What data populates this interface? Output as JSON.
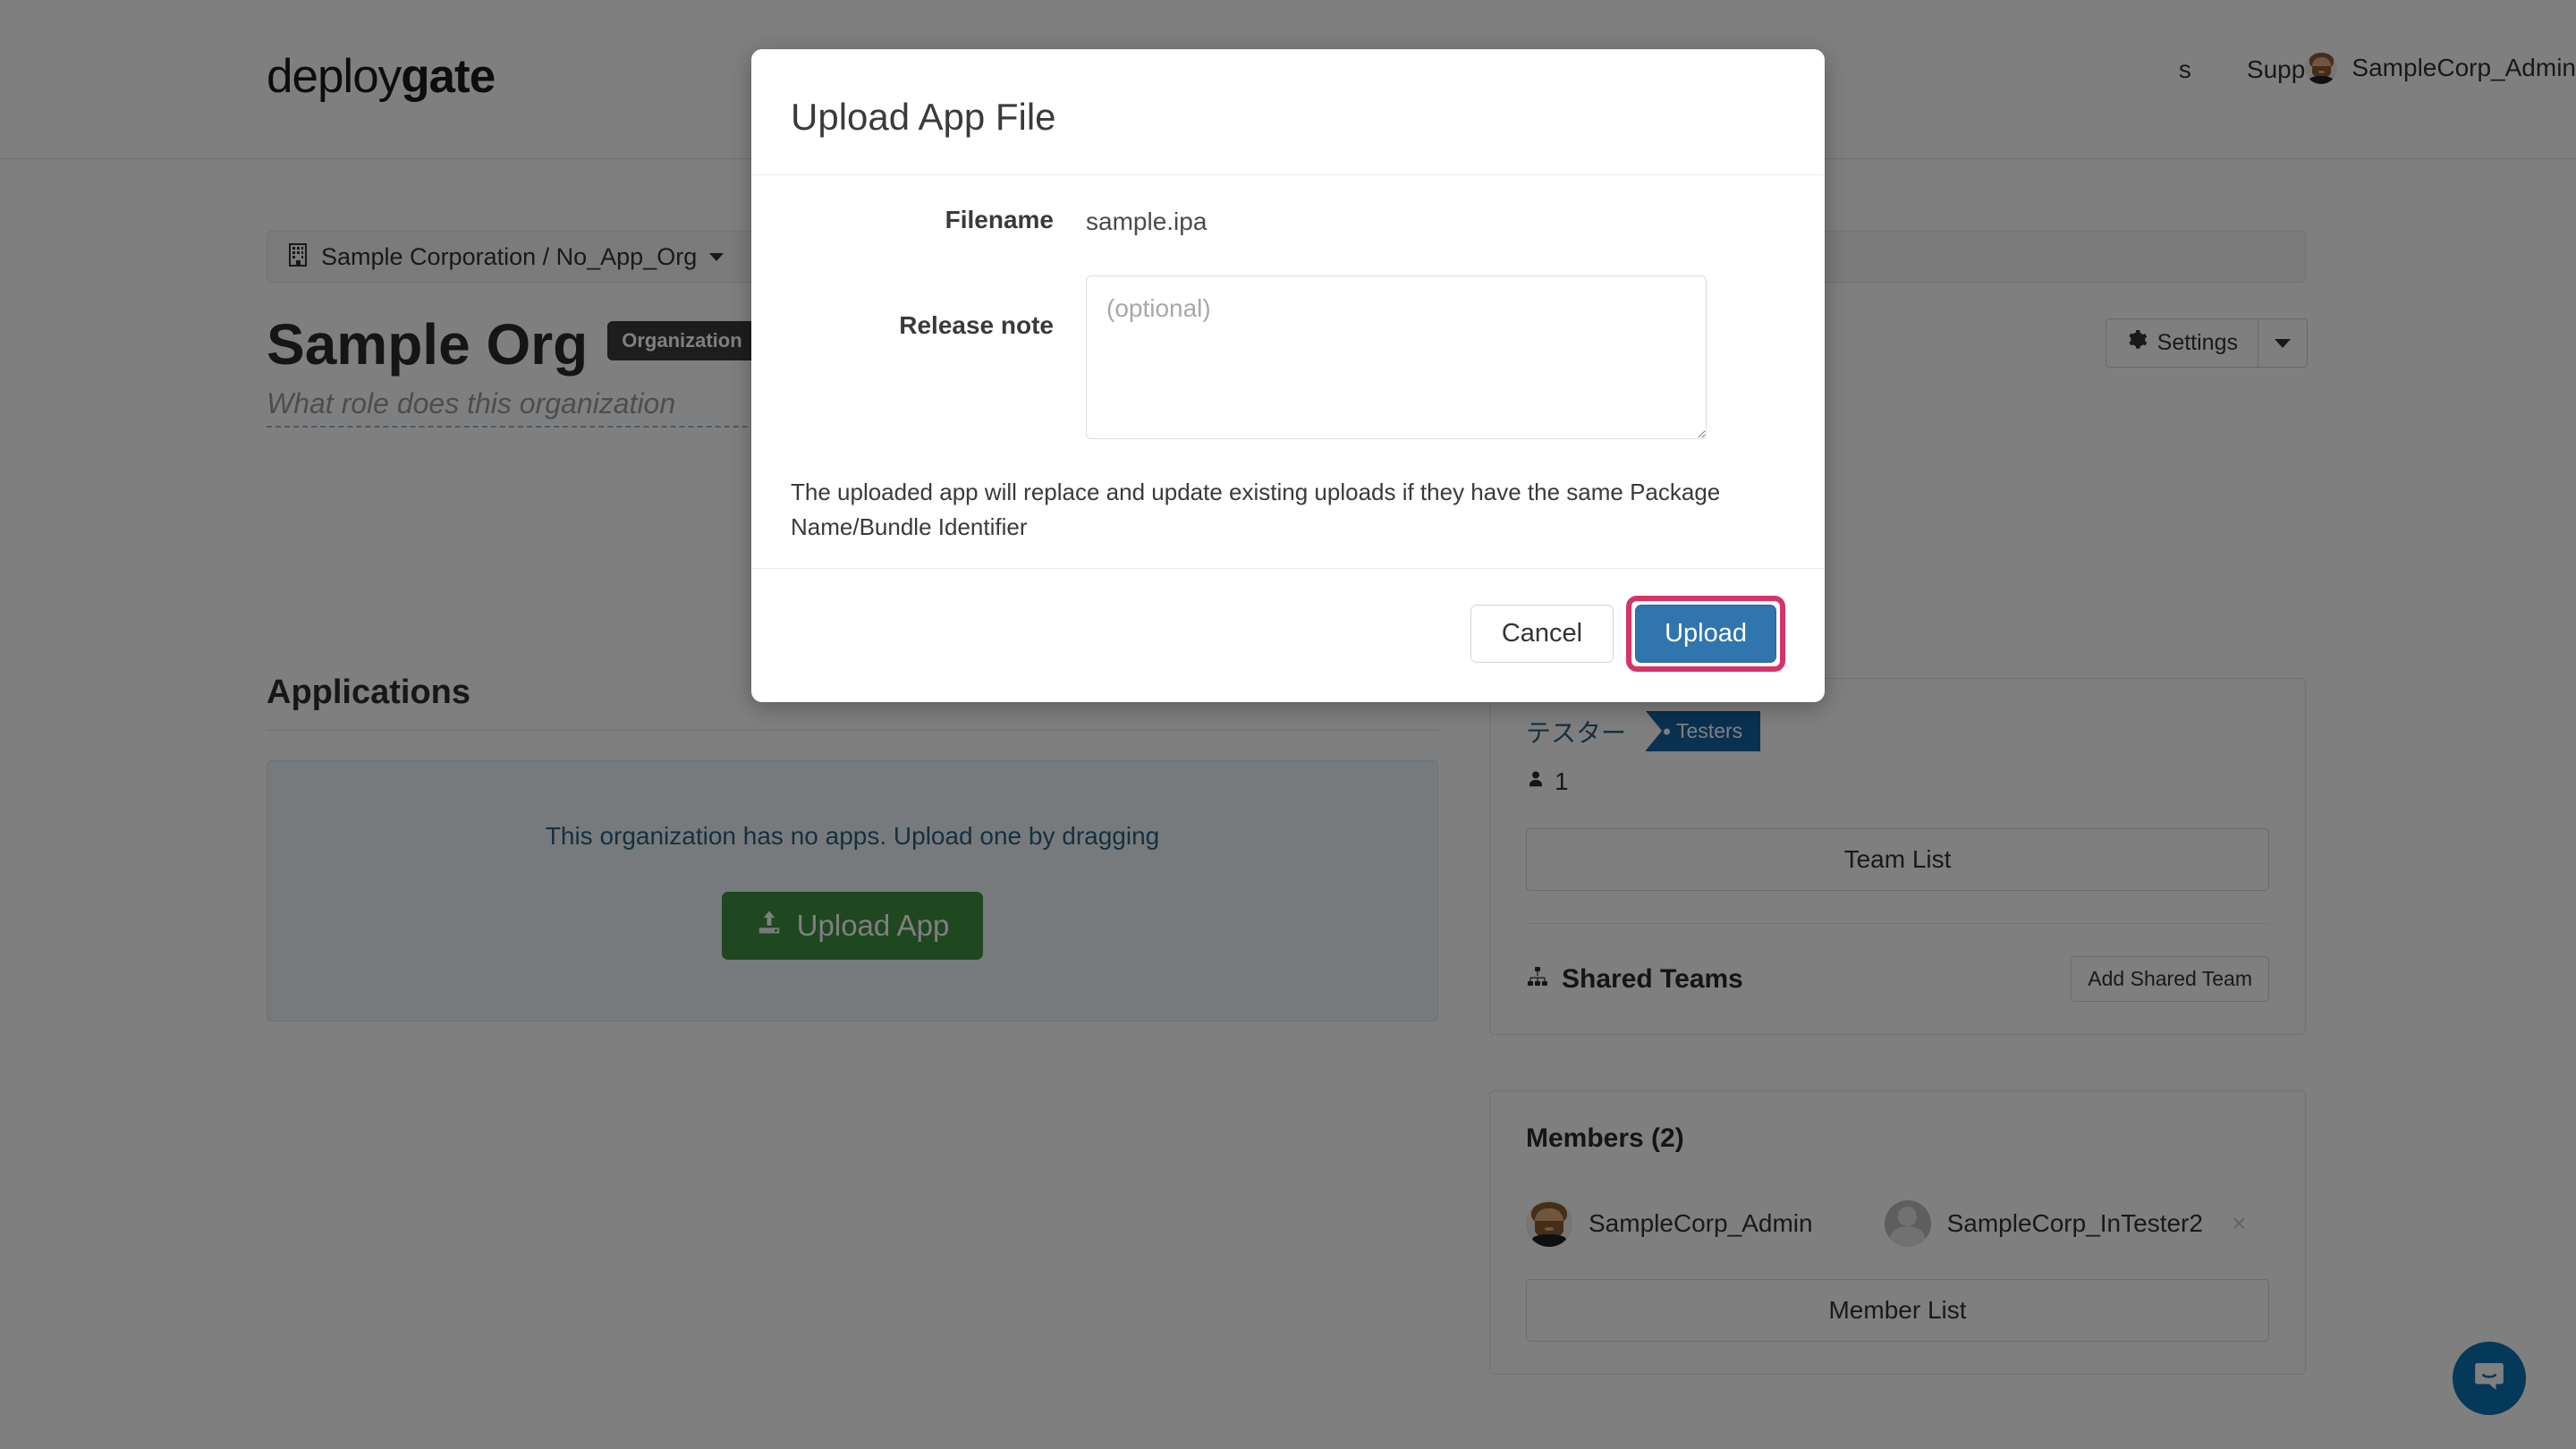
{
  "header": {
    "logo_thin": "deploy",
    "logo_bold": "gate",
    "nav_items": [
      {
        "label": "s"
      },
      {
        "label": "Support"
      }
    ],
    "user_name": "SampleCorp_Admin",
    "user_avatar_icon": "user-avatar-bearded"
  },
  "breadcrumb": {
    "icon": "building-icon",
    "text": "Sample Corporation / No_App_Org",
    "caret_icon": "chevron-down-icon"
  },
  "page": {
    "org_title": "Sample Org",
    "org_badge": "Organization",
    "org_tagline": "What role does this organization",
    "settings_label": "Settings",
    "settings_icon": "gear-icon",
    "settings_caret_icon": "chevron-down-icon"
  },
  "applications": {
    "heading": "Applications",
    "empty_text": "This organization has no apps. Upload one by dragging",
    "upload_button_label": "Upload App",
    "upload_button_icon": "upload-icon"
  },
  "teams": {
    "team_name": "テスター",
    "team_ribbon_label": "Testers",
    "member_count": "1",
    "member_icon": "person-icon",
    "team_list_label": "Team List",
    "shared_teams_label": "Shared Teams",
    "shared_teams_icon": "sitemap-icon",
    "add_shared_team_label": "Add Shared Team"
  },
  "members": {
    "title": "Members (2)",
    "list": [
      {
        "name": "SampleCorp_Admin",
        "avatar_icon": "user-avatar-bearded",
        "removable": false
      },
      {
        "name": "SampleCorp_InTester2",
        "avatar_icon": "user-avatar-generic",
        "removable": true,
        "remove_icon": "close-icon"
      }
    ],
    "member_list_label": "Member List"
  },
  "intercom": {
    "icon": "chat-bubble-icon",
    "color": "#0a72b3"
  },
  "modal": {
    "title": "Upload App File",
    "filename_label": "Filename",
    "filename_value": "sample.ipa",
    "release_note_label": "Release note",
    "release_note_value": "",
    "release_note_placeholder": "(optional)",
    "hint": "The uploaded app will replace and update existing uploads if they have the same Package Name/Bundle Identifier",
    "cancel_label": "Cancel",
    "upload_label": "Upload",
    "upload_highlight_color": "#d6336c",
    "upload_button_color": "#3075ae"
  }
}
